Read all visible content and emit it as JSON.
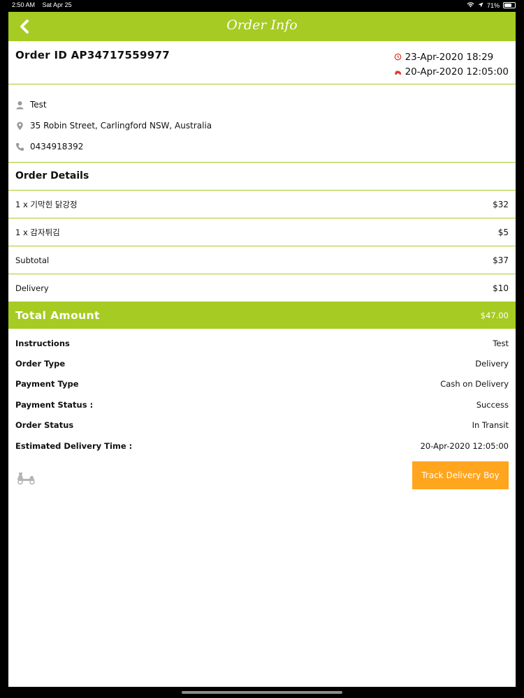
{
  "status_bar": {
    "time": "2:50 AM",
    "date": "Sat Apr 25",
    "battery": "71%",
    "battery_level": 0.71
  },
  "nav": {
    "title": "Order Info"
  },
  "order": {
    "id_label": "Order ID AP34717559977",
    "order_date": "23-Apr-2020 18:29",
    "delivery_date": "20-Apr-2020 12:05:00"
  },
  "customer": {
    "name": "Test",
    "address": "35 Robin Street, Carlingford NSW, Australia",
    "phone": "0434918392"
  },
  "order_details": {
    "title": "Order Details",
    "lines": [
      {
        "label": "1 x 기막힌 닭강정",
        "amount": "$32"
      },
      {
        "label": "1 x 감자튀김",
        "amount": "$5"
      },
      {
        "label": "Subtotal",
        "amount": "$37"
      },
      {
        "label": "Delivery",
        "amount": "$10"
      }
    ]
  },
  "total": {
    "label": "Total Amount",
    "value": "$47.00"
  },
  "info": [
    {
      "key": "Instructions",
      "value": "Test"
    },
    {
      "key": "Order Type",
      "value": "Delivery"
    },
    {
      "key": "Payment Type",
      "value": "Cash on Delivery"
    },
    {
      "key": "Payment Status :",
      "value": "Success"
    },
    {
      "key": "Order Status",
      "value": "In Transit"
    },
    {
      "key": "Estimated Delivery Time :",
      "value": "20-Apr-2020 12:05:00"
    }
  ],
  "actions": {
    "track_label": "Track Delivery Boy"
  },
  "colors": {
    "accent": "#a6cb22",
    "button": "#ffa51e",
    "icon_grey": "#9a9a9a",
    "date_icon": "#e03a2a"
  }
}
